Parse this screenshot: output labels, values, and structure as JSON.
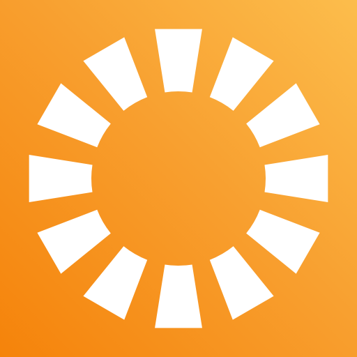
{
  "icon": {
    "name": "sun-burst-icon",
    "ray_count": 12,
    "colors": {
      "gradient_start": "#f5830a",
      "gradient_end": "#fcbd4c",
      "rays": "#ffffff"
    }
  }
}
